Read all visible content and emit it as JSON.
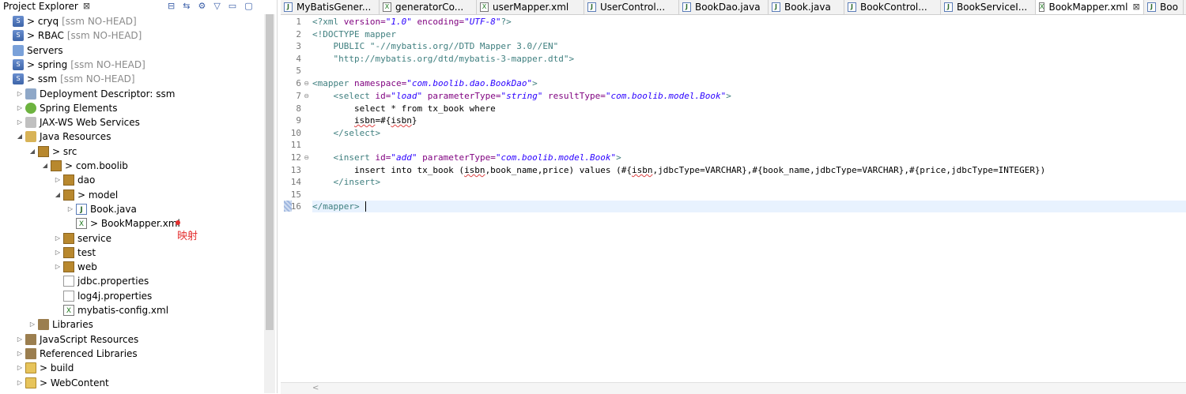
{
  "explorer": {
    "title": "Project Explorer",
    "close": "⊠",
    "toolbar": [
      "⊟",
      "⇆",
      "⚙",
      "▽",
      "▭",
      "▢"
    ]
  },
  "tree": [
    {
      "label": "> cryq",
      "suffix": "[ssm NO-HEAD]",
      "icon": "project-icon",
      "depth": 0,
      "twist": ""
    },
    {
      "label": "> RBAC",
      "suffix": "[ssm NO-HEAD]",
      "icon": "project-icon",
      "depth": 0,
      "twist": ""
    },
    {
      "label": "Servers",
      "suffix": "",
      "icon": "server-folder-icon",
      "depth": 0,
      "twist": ""
    },
    {
      "label": "> spring",
      "suffix": "[ssm NO-HEAD]",
      "icon": "project-icon",
      "depth": 0,
      "twist": ""
    },
    {
      "label": "> ssm",
      "suffix": "[ssm NO-HEAD]",
      "icon": "project-icon",
      "depth": 0,
      "twist": ""
    },
    {
      "label": "Deployment Descriptor: ssm",
      "suffix": "",
      "icon": "deployment-descriptor-icon",
      "depth": 1,
      "twist": "▷"
    },
    {
      "label": "Spring Elements",
      "suffix": "",
      "icon": "spring-icon",
      "depth": 1,
      "twist": "▷"
    },
    {
      "label": "JAX-WS Web Services",
      "suffix": "",
      "icon": "web-services-icon",
      "depth": 1,
      "twist": "▷"
    },
    {
      "label": "Java Resources",
      "suffix": "",
      "icon": "java-resources-icon",
      "depth": 1,
      "twist": "◢"
    },
    {
      "label": "> src",
      "suffix": "",
      "icon": "source-folder-icon",
      "depth": 2,
      "twist": "◢"
    },
    {
      "label": "> com.boolib",
      "suffix": "",
      "icon": "package-icon",
      "depth": 3,
      "twist": "◢"
    },
    {
      "label": "dao",
      "suffix": "",
      "icon": "package-icon",
      "depth": 4,
      "twist": "▷"
    },
    {
      "label": "> model",
      "suffix": "",
      "icon": "package-icon",
      "depth": 4,
      "twist": "◢"
    },
    {
      "label": "Book.java",
      "suffix": "",
      "icon": "java-file-icon",
      "depth": 5,
      "twist": "▷"
    },
    {
      "label": "> BookMapper.xml",
      "suffix": "",
      "icon": "xml-file-icon",
      "depth": 5,
      "twist": ""
    },
    {
      "label": "service",
      "suffix": "",
      "icon": "package-icon",
      "depth": 4,
      "twist": "▷"
    },
    {
      "label": "test",
      "suffix": "",
      "icon": "package-icon",
      "depth": 4,
      "twist": "▷"
    },
    {
      "label": "web",
      "suffix": "",
      "icon": "package-icon",
      "depth": 4,
      "twist": "▷"
    },
    {
      "label": "jdbc.properties",
      "suffix": "",
      "icon": "properties-file-icon",
      "depth": 4,
      "twist": ""
    },
    {
      "label": "log4j.properties",
      "suffix": "",
      "icon": "properties-file-icon",
      "depth": 4,
      "twist": ""
    },
    {
      "label": "mybatis-config.xml",
      "suffix": "",
      "icon": "xml-file-icon",
      "depth": 4,
      "twist": ""
    },
    {
      "label": "Libraries",
      "suffix": "",
      "icon": "library-icon",
      "depth": 2,
      "twist": "▷"
    },
    {
      "label": "JavaScript Resources",
      "suffix": "",
      "icon": "library-icon",
      "depth": 1,
      "twist": "▷"
    },
    {
      "label": "Referenced Libraries",
      "suffix": "",
      "icon": "library-icon",
      "depth": 1,
      "twist": "▷"
    },
    {
      "label": "> build",
      "suffix": "",
      "icon": "folder-icon",
      "depth": 1,
      "twist": "▷"
    },
    {
      "label": "> WebContent",
      "suffix": "",
      "icon": "folder-icon",
      "depth": 1,
      "twist": "▷"
    }
  ],
  "annotation": "映射",
  "tabs": [
    {
      "label": "MyBatisGener...",
      "icon": "j"
    },
    {
      "label": "generatorCo...",
      "icon": "x"
    },
    {
      "label": "userMapper.xml",
      "icon": "x"
    },
    {
      "label": "UserControl...",
      "icon": "j"
    },
    {
      "label": "BookDao.java",
      "icon": "j"
    },
    {
      "label": "Book.java",
      "icon": "j"
    },
    {
      "label": "BookControl...",
      "icon": "j"
    },
    {
      "label": "BookServiceI...",
      "icon": "j"
    },
    {
      "label": "BookMapper.xml",
      "icon": "x",
      "active": true
    },
    {
      "label": "Boo",
      "icon": "j"
    }
  ],
  "tab_close": "⊠",
  "code_lines": [
    "1",
    "2",
    "3",
    "4",
    "5",
    "6",
    "7",
    "8",
    "9",
    "10",
    "11",
    "12",
    "13",
    "14",
    "15",
    "16"
  ],
  "code": {
    "l1a": "<?xml ",
    "l1b": "version=",
    "l1c": "\"1.0\"",
    "l1d": " encoding=",
    "l1e": "\"UTF-8\"",
    "l1f": "?>",
    "l2": "<!DOCTYPE mapper",
    "l3a": "    PUBLIC ",
    "l3b": "\"-//mybatis.org//DTD Mapper 3.0//EN\"",
    "l4": "    \"http://mybatis.org/dtd/mybatis-3-mapper.dtd\">",
    "l6a": "<mapper ",
    "l6b": "namespace=",
    "l6c": "\"com.boolib.dao.BookDao\"",
    "l6d": ">",
    "l7a": "    <select ",
    "l7b": "id=",
    "l7c": "\"load\"",
    "l7d": " parameterType=",
    "l7e": "\"string\"",
    "l7f": " resultType=",
    "l7g": "\"com.boolib.model.Book\"",
    "l7h": ">",
    "l8": "        select * from tx_book where",
    "l9a": "        ",
    "l9b": "isbn",
    "l9c": "=#{",
    "l9d": "isbn",
    "l9e": "}",
    "l10": "    </select>",
    "l12a": "    <insert ",
    "l12b": "id=",
    "l12c": "\"add\"",
    "l12d": " parameterType=",
    "l12e": "\"com.boolib.model.Book\"",
    "l12f": ">",
    "l13a": "        insert into tx_book (",
    "l13b": "isbn",
    "l13c": ",book_name,price) values (#{",
    "l13d": "isbn",
    "l13e": ",jdbcType=VARCHAR},#{book_name,jdbcType=VARCHAR},#{price,jdbcType=INTEGER})",
    "l14": "    </insert>",
    "l16": "</mapper>"
  },
  "colors": {
    "annotation": "#e43030",
    "tag": "#3f7f7f",
    "attr": "#7f007f",
    "value": "#2a00ff"
  }
}
